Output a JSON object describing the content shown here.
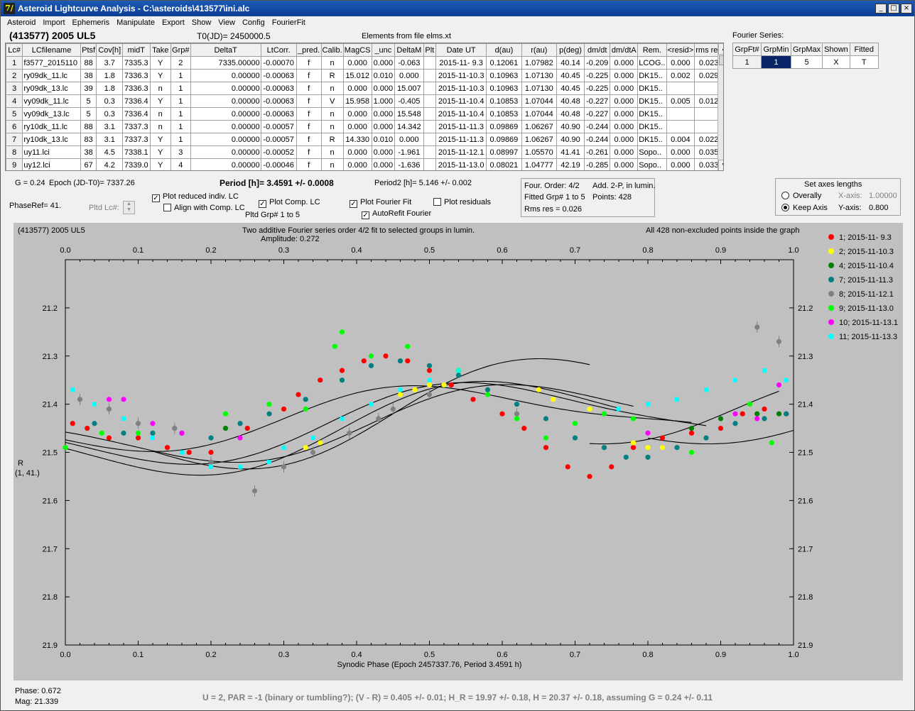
{
  "window": {
    "title": "Asteroid Lightcurve Analysis - C:\\asteroids\\413577\\ini.alc",
    "app_icon": "alc-app-icon"
  },
  "menu": [
    "Asteroid",
    "Import",
    "Ephemeris",
    "Manipulate",
    "Export",
    "Show",
    "View",
    "Config",
    "FourierFit"
  ],
  "header": {
    "object": "(413577) 2005 UL5",
    "t0": "T0(JD)= 2450000.5",
    "elements": "Elements from file elms.xt",
    "fourier_series_label": "Fourier Series:"
  },
  "lc_table": {
    "columns": [
      "Lc#",
      "LCfilename",
      "Ptsf",
      "Cov[h]",
      "midT",
      "Take",
      "Grp#",
      "DeltaT",
      "LtCorr.",
      "_pred.",
      "Calib.",
      "MagCS",
      "_unc",
      "DeltaM",
      "Plt",
      "Date UT",
      "d(au)",
      "r(au)",
      "p(deg)",
      "dm/dt",
      "dm/dtA",
      "Rem.",
      "<resid>",
      "rms res"
    ],
    "rows": [
      [
        "1",
        "f3577_2015110",
        "88",
        "3.7",
        "7335.3",
        "Y",
        "2",
        "7335.00000",
        "-0.00070",
        "f",
        "n",
        "0.000",
        "0.000",
        "-0.063",
        "",
        "2015-11- 9.3",
        "0.12061",
        "1.07982",
        "40.14",
        "-0.209",
        "0.000",
        "LCOG..",
        "0.000",
        "0.023"
      ],
      [
        "2",
        "ry09dk_11.lc",
        "38",
        "1.8",
        "7336.3",
        "Y",
        "1",
        "0.00000",
        "-0.00063",
        "f",
        "R",
        "15.012",
        "0.010",
        "0.000",
        "",
        "2015-11-10.3",
        "0.10963",
        "1.07130",
        "40.45",
        "-0.225",
        "0.000",
        "DK15..",
        "0.002",
        "0.029"
      ],
      [
        "3",
        "ry09dk_13.lc",
        "39",
        "1.8",
        "7336.3",
        "n",
        "1",
        "0.00000",
        "-0.00063",
        "f",
        "n",
        "0.000",
        "0.000",
        "15.007",
        "",
        "2015-11-10.3",
        "0.10963",
        "1.07130",
        "40.45",
        "-0.225",
        "0.000",
        "DK15..",
        "",
        ""
      ],
      [
        "4",
        "vy09dk_11.lc",
        "5",
        "0.3",
        "7336.4",
        "Y",
        "1",
        "0.00000",
        "-0.00063",
        "f",
        "V",
        "15.958",
        "1.000",
        "-0.405",
        "",
        "2015-11-10.4",
        "0.10853",
        "1.07044",
        "40.48",
        "-0.227",
        "0.000",
        "DK15..",
        "0.005",
        "0.012"
      ],
      [
        "5",
        "vy09dk_13.lc",
        "5",
        "0.3",
        "7336.4",
        "n",
        "1",
        "0.00000",
        "-0.00063",
        "f",
        "n",
        "0.000",
        "0.000",
        "15.548",
        "",
        "2015-11-10.4",
        "0.10853",
        "1.07044",
        "40.48",
        "-0.227",
        "0.000",
        "DK15..",
        "",
        ""
      ],
      [
        "6",
        "ry10dk_11.lc",
        "88",
        "3.1",
        "7337.3",
        "n",
        "1",
        "0.00000",
        "-0.00057",
        "f",
        "n",
        "0.000",
        "0.000",
        "14.342",
        "",
        "2015-11-11.3",
        "0.09869",
        "1.06267",
        "40.90",
        "-0.244",
        "0.000",
        "DK15..",
        "",
        ""
      ],
      [
        "7",
        "ry10dk_13.lc",
        "83",
        "3.1",
        "7337.3",
        "Y",
        "1",
        "0.00000",
        "-0.00057",
        "f",
        "R",
        "14.330",
        "0.010",
        "0.000",
        "",
        "2015-11-11.3",
        "0.09869",
        "1.06267",
        "40.90",
        "-0.244",
        "0.000",
        "DK15..",
        "0.004",
        "0.022"
      ],
      [
        "8",
        "uy11.lci",
        "38",
        "4.5",
        "7338.1",
        "Y",
        "3",
        "0.00000",
        "-0.00052",
        "f",
        "n",
        "0.000",
        "0.000",
        "-1.961",
        "",
        "2015-11-12.1",
        "0.08997",
        "1.05570",
        "41.41",
        "-0.261",
        "0.000",
        "Sopo..",
        "0.000",
        "0.035"
      ],
      [
        "9",
        "uy12.lci",
        "67",
        "4.2",
        "7339.0",
        "Y",
        "4",
        "0.00000",
        "-0.00046",
        "f",
        "n",
        "0.000",
        "0.000",
        "-1.636",
        "",
        "2015-11-13.0",
        "0.08021",
        "1.04777",
        "42.19",
        "-0.285",
        "0.000",
        "Sopo..",
        "0.000",
        "0.033"
      ]
    ]
  },
  "fourier_table": {
    "columns": [
      "GrpFt#",
      "GrpMin",
      "GrpMax",
      "Shown",
      "Fitted"
    ],
    "row": [
      "1",
      "1",
      "5",
      "X",
      "T"
    ]
  },
  "controls": {
    "g": "G = 0.24",
    "epoch": "Epoch (JD-T0)= 7337.26",
    "period": "Period [h]= 3.4591 +/- 0.0008",
    "period2": "Period2 [h]= 5.146 +/- 0.002",
    "phaseref": "PhaseRef= 41.",
    "pltd_lc": "Pltd Lc#:",
    "cb_reduced": "Plot reduced indiv. LC",
    "cb_align": "Align with Comp. LC",
    "cb_comp": "Plot Comp. LC",
    "pltd_grp": "Pltd Grp#  1   to   5",
    "cb_fourier": "Plot Fourier Fit",
    "cb_autorefit": "AutoRefit Fourier",
    "cb_resid": "Plot residuals",
    "info1": "Four. Order:  4/2",
    "info2": "Add. 2-P, in lumin.",
    "info3": "Fitted Grp# 1 to 5",
    "info4": "Points: 428",
    "info5": "Rms res      = 0.026",
    "axes_title": "Set axes lengths",
    "overally": "Overally",
    "keep_axis": "Keep Axis",
    "xaxis_label": "X-axis:",
    "xaxis_val": "1.00000",
    "yaxis_label": "Y-axis:",
    "yaxis_val": "0.800"
  },
  "plot_text": {
    "object": "(413577) 2005 UL5",
    "title": "Two additive Fourier series order 4/2 fit to selected groups in lumin.",
    "amplitude": "Amplitude: 0.272",
    "points_note": "All 428 non-excluded points inside the graph",
    "ylabel1": "R",
    "ylabel2": "(1, 41.)"
  },
  "status": {
    "phase": "Phase:  0.672",
    "mag": "Mag:    21.339",
    "summary": "U = 2, PAR = -1 (binary or tumbling?); (V - R) = 0.405 +/- 0.01; H_R = 19.97 +/- 0.18, H = 20.37 +/- 0.18, assuming G = 0.24 +/- 0.11"
  },
  "chart_data": {
    "type": "scatter",
    "xlabel": "Synodic Phase (Epoch 2457337.76, Period 3.4591 h)",
    "ylabel": "R",
    "xlim": [
      0,
      1
    ],
    "ylim": [
      21.9,
      21.1
    ],
    "xticks": [
      "0.0",
      "0.1",
      "0.2",
      "0.3",
      "0.4",
      "0.5",
      "0.6",
      "0.7",
      "0.8",
      "0.9",
      "1.0"
    ],
    "yticks": [
      "21.2",
      "21.3",
      "21.4",
      "21.5",
      "21.6",
      "21.7",
      "21.8",
      "21.9"
    ],
    "legend": [
      {
        "name": "1; 2015-11- 9.3",
        "color": "#ff0000"
      },
      {
        "name": "2; 2015-11-10.3",
        "color": "#ffff00"
      },
      {
        "name": "4; 2015-11-10.4",
        "color": "#008000"
      },
      {
        "name": "7; 2015-11-11.3",
        "color": "#008080"
      },
      {
        "name": "8; 2015-11-12.1",
        "color": "#808080"
      },
      {
        "name": "9; 2015-11-13.0",
        "color": "#00ff00"
      },
      {
        "name": "10; 2015-11-13.1",
        "color": "#ff00ff"
      },
      {
        "name": "11; 2015-11-13.3",
        "color": "#00ffff"
      }
    ],
    "series": [
      {
        "name": "1; 2015-11- 9.3",
        "color": "#ff0000",
        "marker": "circle",
        "points": [
          [
            0.01,
            21.44
          ],
          [
            0.03,
            21.45
          ],
          [
            0.06,
            21.47
          ],
          [
            0.1,
            21.47
          ],
          [
            0.14,
            21.49
          ],
          [
            0.17,
            21.5
          ],
          [
            0.2,
            21.5
          ],
          [
            0.25,
            21.45
          ],
          [
            0.3,
            21.41
          ],
          [
            0.32,
            21.38
          ],
          [
            0.35,
            21.35
          ],
          [
            0.38,
            21.33
          ],
          [
            0.41,
            21.31
          ],
          [
            0.44,
            21.3
          ],
          [
            0.47,
            21.31
          ],
          [
            0.5,
            21.33
          ],
          [
            0.53,
            21.36
          ],
          [
            0.56,
            21.39
          ],
          [
            0.6,
            21.42
          ],
          [
            0.63,
            21.45
          ],
          [
            0.66,
            21.49
          ],
          [
            0.69,
            21.53
          ],
          [
            0.72,
            21.55
          ],
          [
            0.75,
            21.53
          ],
          [
            0.78,
            21.49
          ],
          [
            0.82,
            21.47
          ],
          [
            0.86,
            21.46
          ],
          [
            0.9,
            21.45
          ],
          [
            0.93,
            21.42
          ],
          [
            0.96,
            21.41
          ],
          [
            0.99,
            21.42
          ]
        ]
      },
      {
        "name": "2; 2015-11-10.3",
        "color": "#ffff00",
        "marker": "circle",
        "points": [
          [
            0.33,
            21.49
          ],
          [
            0.35,
            21.48
          ],
          [
            0.46,
            21.38
          ],
          [
            0.48,
            21.37
          ],
          [
            0.5,
            21.36
          ],
          [
            0.52,
            21.36
          ],
          [
            0.65,
            21.37
          ],
          [
            0.67,
            21.39
          ],
          [
            0.72,
            21.41
          ],
          [
            0.78,
            21.48
          ],
          [
            0.8,
            21.49
          ],
          [
            0.82,
            21.49
          ]
        ]
      },
      {
        "name": "4; 2015-11-10.4",
        "color": "#008000",
        "marker": "circle",
        "points": [
          [
            0.22,
            21.45
          ],
          [
            0.86,
            21.45
          ],
          [
            0.9,
            21.43
          ],
          [
            0.95,
            21.42
          ],
          [
            0.98,
            21.42
          ]
        ]
      },
      {
        "name": "7; 2015-11-11.3",
        "color": "#008080",
        "marker": "circle",
        "points": [
          [
            0.04,
            21.44
          ],
          [
            0.08,
            21.46
          ],
          [
            0.12,
            21.46
          ],
          [
            0.16,
            21.46
          ],
          [
            0.2,
            21.47
          ],
          [
            0.24,
            21.44
          ],
          [
            0.28,
            21.42
          ],
          [
            0.33,
            21.39
          ],
          [
            0.38,
            21.35
          ],
          [
            0.42,
            21.32
          ],
          [
            0.46,
            21.31
          ],
          [
            0.5,
            21.32
          ],
          [
            0.54,
            21.34
          ],
          [
            0.58,
            21.37
          ],
          [
            0.62,
            21.4
          ],
          [
            0.66,
            21.43
          ],
          [
            0.7,
            21.47
          ],
          [
            0.74,
            21.49
          ],
          [
            0.77,
            21.51
          ],
          [
            0.8,
            21.51
          ],
          [
            0.84,
            21.49
          ],
          [
            0.88,
            21.47
          ],
          [
            0.92,
            21.44
          ],
          [
            0.96,
            21.43
          ],
          [
            0.99,
            21.42
          ]
        ]
      },
      {
        "name": "8; 2015-11-12.1",
        "color": "#808080",
        "marker": "circle",
        "errorbar": true,
        "points": [
          [
            0.02,
            21.39
          ],
          [
            0.06,
            21.41
          ],
          [
            0.1,
            21.44
          ],
          [
            0.15,
            21.45
          ],
          [
            0.2,
            21.52
          ],
          [
            0.26,
            21.58
          ],
          [
            0.3,
            21.53
          ],
          [
            0.34,
            21.5
          ],
          [
            0.39,
            21.46
          ],
          [
            0.43,
            21.43
          ],
          [
            0.45,
            21.41
          ],
          [
            0.5,
            21.38
          ],
          [
            0.62,
            21.42
          ],
          [
            0.95,
            21.24
          ],
          [
            0.98,
            21.27
          ]
        ]
      },
      {
        "name": "9; 2015-11-13.0",
        "color": "#00ff00",
        "marker": "circle",
        "points": [
          [
            0.0,
            21.49
          ],
          [
            0.05,
            21.46
          ],
          [
            0.1,
            21.46
          ],
          [
            0.22,
            21.42
          ],
          [
            0.28,
            21.4
          ],
          [
            0.33,
            21.41
          ],
          [
            0.37,
            21.28
          ],
          [
            0.38,
            21.25
          ],
          [
            0.42,
            21.3
          ],
          [
            0.47,
            21.28
          ],
          [
            0.54,
            21.33
          ],
          [
            0.58,
            21.38
          ],
          [
            0.62,
            21.43
          ],
          [
            0.66,
            21.47
          ],
          [
            0.7,
            21.44
          ],
          [
            0.74,
            21.42
          ],
          [
            0.78,
            21.43
          ],
          [
            0.86,
            21.5
          ],
          [
            0.94,
            21.4
          ],
          [
            0.97,
            21.48
          ]
        ]
      },
      {
        "name": "10; 2015-11-13.1",
        "color": "#ff00ff",
        "marker": "circle",
        "points": [
          [
            0.06,
            21.39
          ],
          [
            0.08,
            21.39
          ],
          [
            0.12,
            21.44
          ],
          [
            0.16,
            21.46
          ],
          [
            0.24,
            21.47
          ],
          [
            0.8,
            21.46
          ],
          [
            0.92,
            21.42
          ],
          [
            0.95,
            21.43
          ],
          [
            0.98,
            21.36
          ]
        ]
      },
      {
        "name": "11; 2015-11-13.3",
        "color": "#00ffff",
        "marker": "square",
        "points": [
          [
            0.01,
            21.37
          ],
          [
            0.04,
            21.4
          ],
          [
            0.08,
            21.43
          ],
          [
            0.12,
            21.47
          ],
          [
            0.16,
            21.5
          ],
          [
            0.2,
            21.53
          ],
          [
            0.24,
            21.53
          ],
          [
            0.28,
            21.52
          ],
          [
            0.3,
            21.49
          ],
          [
            0.34,
            21.47
          ],
          [
            0.38,
            21.43
          ],
          [
            0.42,
            21.4
          ],
          [
            0.46,
            21.37
          ],
          [
            0.5,
            21.35
          ],
          [
            0.54,
            21.33
          ],
          [
            0.76,
            21.41
          ],
          [
            0.8,
            21.4
          ],
          [
            0.84,
            21.39
          ],
          [
            0.88,
            21.37
          ],
          [
            0.92,
            21.35
          ],
          [
            0.96,
            21.33
          ],
          [
            0.99,
            21.35
          ]
        ]
      }
    ],
    "fit_curves": [
      {
        "x0": 0.0,
        "x1": 0.86,
        "mean": 21.43,
        "amp": 0.065,
        "phase": 0.3
      },
      {
        "x0": 0.0,
        "x1": 0.88,
        "mean": 21.44,
        "amp": 0.085,
        "phase": 0.36
      },
      {
        "x0": 0.0,
        "x1": 0.76,
        "mean": 21.45,
        "amp": 0.1,
        "phase": 0.38
      },
      {
        "x0": 0.0,
        "x1": 0.78,
        "mean": 21.44,
        "amp": 0.08,
        "phase": 0.42
      },
      {
        "x0": 0.12,
        "x1": 0.72,
        "mean": 21.42,
        "amp": 0.12,
        "phase": 0.45
      },
      {
        "x0": 0.72,
        "x1": 0.98,
        "mean": 21.41,
        "amp": 0.07,
        "phase": 0.92
      },
      {
        "x0": 0.8,
        "x1": 1.0,
        "mean": 21.43,
        "amp": 0.045,
        "phase": 0.05
      }
    ]
  }
}
